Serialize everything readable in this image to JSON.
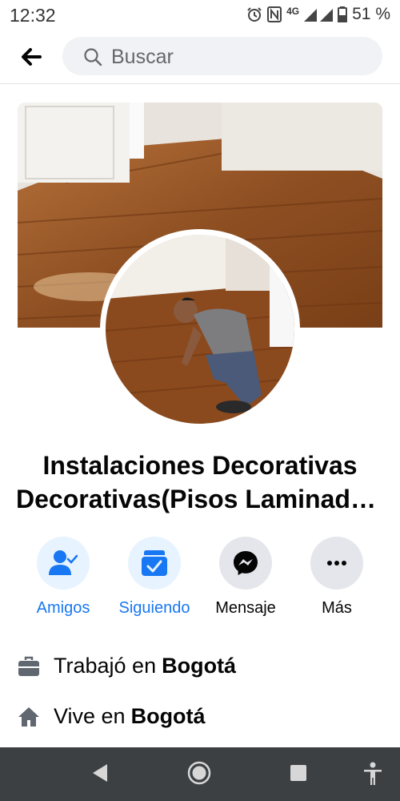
{
  "status_bar": {
    "time": "12:32",
    "network": "4G",
    "battery": "51 %",
    "icons": [
      "alarm-icon",
      "nfc-icon",
      "signal-icon",
      "battery-icon"
    ]
  },
  "header": {
    "back_icon": "arrow-left-icon",
    "search_placeholder": "Buscar",
    "search_icon": "search-icon"
  },
  "profile": {
    "name_line1": "Instalaciones Decorativas",
    "name_line2": "Decorativas(Pisos Laminados)"
  },
  "actions": [
    {
      "label": "Amigos",
      "icon": "friends-icon"
    },
    {
      "label": "Siguiendo",
      "icon": "following-icon"
    },
    {
      "label": "Mensaje",
      "icon": "messenger-icon"
    },
    {
      "label": "Más",
      "icon": "more-icon"
    }
  ],
  "info": {
    "work_prefix": "Trabajó en",
    "work_place": "Bogotá",
    "home_prefix": "Vive en",
    "home_place": "Bogotá"
  },
  "colors": {
    "accent": "#1877f2",
    "accent_bg": "#e7f3ff",
    "gray_bg": "#e4e6eb",
    "nav_bar": "#3c4043"
  }
}
